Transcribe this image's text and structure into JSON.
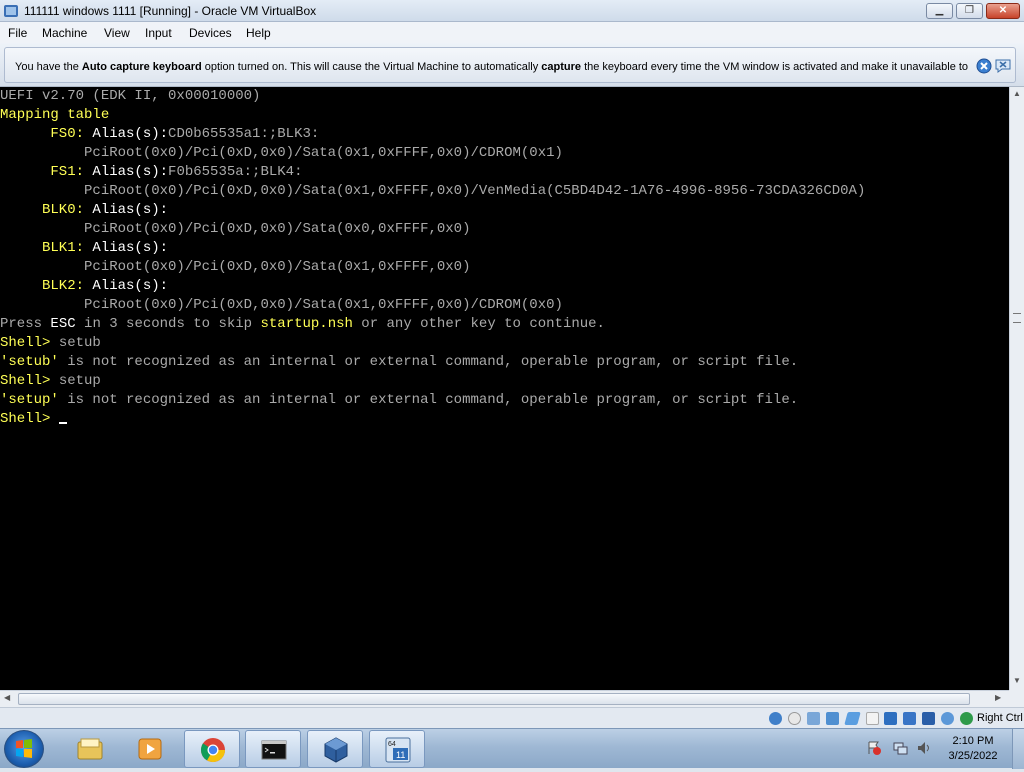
{
  "window": {
    "title": "111111 windows 1111 [Running] - Oracle VM VirtualBox",
    "minimize_label": "▁",
    "maximize_label": "❐",
    "close_label": "✕"
  },
  "menu": [
    "File",
    "Machine",
    "View",
    "Input",
    "Devices",
    "Help"
  ],
  "notice": {
    "part1": "You have the ",
    "bold1": "Auto capture keyboard",
    "part2": " option turned on. This will cause the Virtual Machine to automatically ",
    "bold2": "capture",
    "part3": " the keyboard every time the VM window is activated and make it unavailable to"
  },
  "terminal": {
    "lines": [
      [
        {
          "t": "UEFI v2.70 (EDK II, 0x00010000)",
          "c": "g"
        }
      ],
      [
        {
          "t": "Mapping table",
          "c": "y"
        }
      ],
      [
        {
          "t": "      FS0: ",
          "c": "y"
        },
        {
          "t": "Alias(s):",
          "c": "w"
        },
        {
          "t": "CD0b65535a1:;BLK3:",
          "c": "g"
        }
      ],
      [
        {
          "t": "          PciRoot(0x0)/Pci(0xD,0x0)/Sata(0x1,0xFFFF,0x0)/CDROM(0x1)",
          "c": "g"
        }
      ],
      [
        {
          "t": "      FS1: ",
          "c": "y"
        },
        {
          "t": "Alias(s):",
          "c": "w"
        },
        {
          "t": "F0b65535a:;BLK4:",
          "c": "g"
        }
      ],
      [
        {
          "t": "          PciRoot(0x0)/Pci(0xD,0x0)/Sata(0x1,0xFFFF,0x0)/VenMedia(C5BD4D42-1A76-4996-8956-73CDA326CD0A)",
          "c": "g"
        }
      ],
      [
        {
          "t": "     BLK0: ",
          "c": "y"
        },
        {
          "t": "Alias(s):",
          "c": "w"
        }
      ],
      [
        {
          "t": "          PciRoot(0x0)/Pci(0xD,0x0)/Sata(0x0,0xFFFF,0x0)",
          "c": "g"
        }
      ],
      [
        {
          "t": "     BLK1: ",
          "c": "y"
        },
        {
          "t": "Alias(s):",
          "c": "w"
        }
      ],
      [
        {
          "t": "          PciRoot(0x0)/Pci(0xD,0x0)/Sata(0x1,0xFFFF,0x0)",
          "c": "g"
        }
      ],
      [
        {
          "t": "     BLK2: ",
          "c": "y"
        },
        {
          "t": "Alias(s):",
          "c": "w"
        }
      ],
      [
        {
          "t": "          PciRoot(0x0)/Pci(0xD,0x0)/Sata(0x1,0xFFFF,0x0)/CDROM(0x0)",
          "c": "g"
        }
      ],
      [
        {
          "t": "Press ",
          "c": "g"
        },
        {
          "t": "ESC",
          "c": "w"
        },
        {
          "t": " in 3 seconds to skip ",
          "c": "g"
        },
        {
          "t": "startup.nsh",
          "c": "y"
        },
        {
          "t": " or any other key to continue.",
          "c": "g"
        }
      ],
      [
        {
          "t": "Shell> ",
          "c": "y"
        },
        {
          "t": "setub",
          "c": "g"
        }
      ],
      [
        {
          "t": "'setub'",
          "c": "y"
        },
        {
          "t": " is not recognized as an internal or external command, operable program, or script file.",
          "c": "g"
        }
      ],
      [
        {
          "t": "Shell> ",
          "c": "y"
        },
        {
          "t": "setup",
          "c": "g"
        }
      ],
      [
        {
          "t": "'setup'",
          "c": "y"
        },
        {
          "t": " is not recognized as an internal or external command, operable program, or script file.",
          "c": "g"
        }
      ],
      [
        {
          "t": "Shell> ",
          "c": "y"
        }
      ]
    ]
  },
  "statusbar": {
    "host_key": "Right Ctrl"
  },
  "clock": {
    "time": "2:10 PM",
    "date": "3/25/2022"
  },
  "colors": {
    "terminal_bg": "#000000",
    "terminal_yellow": "#ffff55",
    "terminal_white": "#ffffff",
    "terminal_gray": "#aaaaaa"
  },
  "icons": {
    "status": [
      "hard-disk-icon",
      "optical-drive-icon",
      "audio-icon",
      "network-icon",
      "usb-icon",
      "shared-folders-icon",
      "display-icon",
      "video-capture-icon",
      "cpu-virtualization-icon",
      "mouse-integration-icon",
      "keyboard-capture-icon"
    ],
    "taskbar": [
      "start-orb-icon",
      "file-explorer-icon",
      "media-player-icon",
      "chrome-icon",
      "command-prompt-icon",
      "virtualbox-icon",
      "virtualbox-vm-icon"
    ]
  }
}
